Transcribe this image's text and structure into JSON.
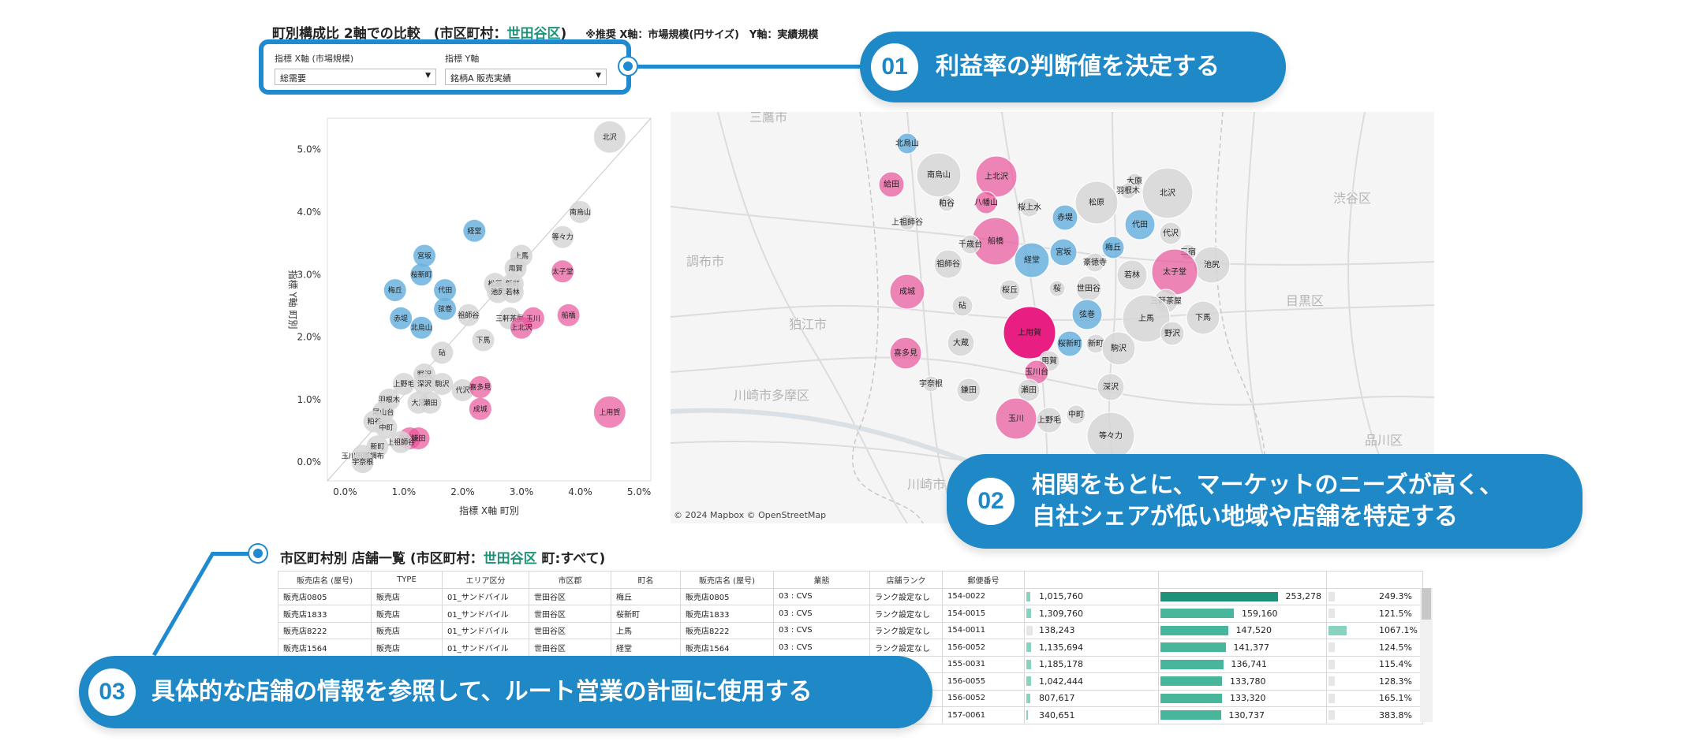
{
  "header": {
    "title_prefix": "町別構成比 2軸での比較　(市区町村：",
    "title_city": "世田谷区",
    "title_suffix": ")",
    "note": "※推奨 X軸：市場規模(円サイズ)　Y軸：実績規模"
  },
  "filters": {
    "x_label": "指標 X軸 (市場規模)",
    "x_value": "総需要",
    "y_label": "指標 Y軸",
    "y_value": "銘柄A 販売実績"
  },
  "callouts": [
    {
      "num": "01",
      "text": "利益率の判断値を決定する"
    },
    {
      "num": "02",
      "text": "相関をもとに、マーケットのニーズが高く、",
      "text2": "自社シェアが低い地域や店舗を特定する"
    },
    {
      "num": "03",
      "text": "具体的な店舗の情報を参照して、ルート営業の計画に使用する"
    }
  ],
  "colors": {
    "accent_blue": "#1f88c6",
    "green": "#1e9278",
    "pink": "#e8559a",
    "blue_dot": "#5aa9d6",
    "gray_dot": "#d4d4d4"
  },
  "chart_data": {
    "type": "scatter",
    "title": "",
    "xlabel": "指標 X軸 町別",
    "ylabel": "指標 Y軸 町別",
    "xlim": [
      -0.3,
      5.2
    ],
    "ylim": [
      -0.3,
      5.5
    ],
    "x_ticks": [
      "0.0%",
      "1.0%",
      "2.0%",
      "3.0%",
      "4.0%",
      "5.0%"
    ],
    "y_ticks": [
      "0.0%",
      "1.0%",
      "2.0%",
      "3.0%",
      "4.0%",
      "5.0%"
    ],
    "grid": false,
    "diagonal_reference_line": true,
    "points": [
      {
        "name": "北沢",
        "x": 4.5,
        "y": 5.2,
        "group": "gray"
      },
      {
        "name": "南烏山",
        "x": 4.0,
        "y": 4.0,
        "group": "gray"
      },
      {
        "name": "等々力",
        "x": 3.7,
        "y": 3.6,
        "group": "gray"
      },
      {
        "name": "経堂",
        "x": 2.2,
        "y": 3.7,
        "group": "blue"
      },
      {
        "name": "太子堂",
        "x": 3.7,
        "y": 3.05,
        "group": "pink"
      },
      {
        "name": "上馬",
        "x": 3.0,
        "y": 3.3,
        "group": "gray"
      },
      {
        "name": "用賀",
        "x": 2.9,
        "y": 3.1,
        "group": "gray"
      },
      {
        "name": "宮坂",
        "x": 1.35,
        "y": 3.3,
        "group": "blue"
      },
      {
        "name": "桜新町",
        "x": 1.3,
        "y": 3.0,
        "group": "blue"
      },
      {
        "name": "梅丘",
        "x": 0.85,
        "y": 2.75,
        "group": "blue"
      },
      {
        "name": "代田",
        "x": 1.7,
        "y": 2.75,
        "group": "blue"
      },
      {
        "name": "松原",
        "x": 2.55,
        "y": 2.85,
        "group": "gray"
      },
      {
        "name": "新町",
        "x": 2.85,
        "y": 2.85,
        "group": "gray"
      },
      {
        "name": "池尻",
        "x": 2.6,
        "y": 2.72,
        "group": "gray"
      },
      {
        "name": "若林",
        "x": 2.85,
        "y": 2.72,
        "group": "gray"
      },
      {
        "name": "弦巻",
        "x": 1.7,
        "y": 2.45,
        "group": "blue"
      },
      {
        "name": "赤堤",
        "x": 0.95,
        "y": 2.3,
        "group": "blue"
      },
      {
        "name": "祖師谷",
        "x": 2.1,
        "y": 2.35,
        "group": "gray"
      },
      {
        "name": "北烏山",
        "x": 1.3,
        "y": 2.15,
        "group": "blue"
      },
      {
        "name": "三軒茶屋",
        "x": 2.8,
        "y": 2.3,
        "group": "gray"
      },
      {
        "name": "玉川",
        "x": 3.2,
        "y": 2.3,
        "group": "pink"
      },
      {
        "name": "上北沢",
        "x": 3.0,
        "y": 2.15,
        "group": "pink"
      },
      {
        "name": "船橋",
        "x": 3.8,
        "y": 2.35,
        "group": "pink"
      },
      {
        "name": "下馬",
        "x": 2.35,
        "y": 1.95,
        "group": "gray"
      },
      {
        "name": "砧",
        "x": 1.65,
        "y": 1.75,
        "group": "gray"
      },
      {
        "name": "野沢",
        "x": 1.35,
        "y": 1.4,
        "group": "gray"
      },
      {
        "name": "上野毛",
        "x": 1.0,
        "y": 1.25,
        "group": "gray"
      },
      {
        "name": "深沢",
        "x": 1.35,
        "y": 1.25,
        "group": "gray"
      },
      {
        "name": "駒沢",
        "x": 1.65,
        "y": 1.25,
        "group": "gray"
      },
      {
        "name": "代沢",
        "x": 2.0,
        "y": 1.15,
        "group": "gray"
      },
      {
        "name": "喜多見",
        "x": 2.3,
        "y": 1.2,
        "group": "pink"
      },
      {
        "name": "羽根木",
        "x": 0.75,
        "y": 1.0,
        "group": "gray"
      },
      {
        "name": "大原",
        "x": 1.25,
        "y": 0.95,
        "group": "gray"
      },
      {
        "name": "瀬田",
        "x": 1.45,
        "y": 0.95,
        "group": "gray"
      },
      {
        "name": "成城",
        "x": 2.3,
        "y": 0.85,
        "group": "pink"
      },
      {
        "name": "上用賀",
        "x": 4.5,
        "y": 0.8,
        "group": "pink"
      },
      {
        "name": "尾山台",
        "x": 0.65,
        "y": 0.8,
        "group": "gray"
      },
      {
        "name": "粕谷",
        "x": 0.5,
        "y": 0.65,
        "group": "gray"
      },
      {
        "name": "中町",
        "x": 0.7,
        "y": 0.55,
        "group": "gray"
      },
      {
        "name": "八幡山",
        "x": 1.1,
        "y": 0.38,
        "group": "pink"
      },
      {
        "name": "鎌田",
        "x": 1.25,
        "y": 0.38,
        "group": "pink"
      },
      {
        "name": "上祖師谷",
        "x": 0.95,
        "y": 0.32,
        "group": "gray"
      },
      {
        "name": "新町",
        "x": 0.55,
        "y": 0.25,
        "group": "gray"
      },
      {
        "name": "玉川田園調布",
        "x": 0.3,
        "y": 0.1,
        "group": "gray"
      },
      {
        "name": "宇奈根",
        "x": 0.3,
        "y": 0.0,
        "group": "gray"
      }
    ]
  },
  "map": {
    "attribution": "© 2024 Mapbox © OpenStreetMap",
    "places": [
      "調布市",
      "狛江市",
      "川崎市多摩区",
      "目黒区",
      "渋谷区",
      "品川区",
      "三鷹市",
      "川崎市"
    ],
    "bubbles": [
      {
        "name": "北烏山",
        "color": "blue"
      },
      {
        "name": "南烏山",
        "color": "gray"
      },
      {
        "name": "上北沢",
        "color": "pink"
      },
      {
        "name": "八幡山",
        "color": "pink"
      },
      {
        "name": "給田",
        "color": "pink"
      },
      {
        "name": "粕谷",
        "color": "gray"
      },
      {
        "name": "桜上水",
        "color": "gray"
      },
      {
        "name": "松原",
        "color": "gray"
      },
      {
        "name": "大原",
        "color": "gray"
      },
      {
        "name": "羽根木",
        "color": "gray"
      },
      {
        "name": "北沢",
        "color": "gray"
      },
      {
        "name": "上祖師谷",
        "color": "gray"
      },
      {
        "name": "船橋",
        "color": "pink"
      },
      {
        "name": "赤堤",
        "color": "blue"
      },
      {
        "name": "代田",
        "color": "blue"
      },
      {
        "name": "代沢",
        "color": "gray"
      },
      {
        "name": "千歳台",
        "color": "gray"
      },
      {
        "name": "経堂",
        "color": "blue"
      },
      {
        "name": "宮坂",
        "color": "blue"
      },
      {
        "name": "梅丘",
        "color": "blue"
      },
      {
        "name": "豪徳寺",
        "color": "gray"
      },
      {
        "name": "三宿",
        "color": "gray"
      },
      {
        "name": "池尻",
        "color": "gray"
      },
      {
        "name": "祖師谷",
        "color": "gray"
      },
      {
        "name": "若林",
        "color": "gray"
      },
      {
        "name": "太子堂",
        "color": "pink"
      },
      {
        "name": "成城",
        "color": "pink"
      },
      {
        "name": "桜丘",
        "color": "gray"
      },
      {
        "name": "桜",
        "color": "gray"
      },
      {
        "name": "世田谷",
        "color": "gray"
      },
      {
        "name": "三軒茶屋",
        "color": "gray"
      },
      {
        "name": "砧",
        "color": "gray"
      },
      {
        "name": "弦巻",
        "color": "blue"
      },
      {
        "name": "上馬",
        "color": "gray"
      },
      {
        "name": "下馬",
        "color": "gray"
      },
      {
        "name": "野沢",
        "color": "gray"
      },
      {
        "name": "上用賀",
        "color": "pink-strong"
      },
      {
        "name": "大蔵",
        "color": "gray"
      },
      {
        "name": "喜多見",
        "color": "pink"
      },
      {
        "name": "桜新町",
        "color": "blue"
      },
      {
        "name": "新町",
        "color": "gray"
      },
      {
        "name": "駒沢",
        "color": "gray"
      },
      {
        "name": "用賀",
        "color": "gray"
      },
      {
        "name": "玉川台",
        "color": "pink"
      },
      {
        "name": "宇奈根",
        "color": "gray"
      },
      {
        "name": "鎌田",
        "color": "gray"
      },
      {
        "name": "瀬田",
        "color": "gray"
      },
      {
        "name": "深沢",
        "color": "gray"
      },
      {
        "name": "玉川",
        "color": "pink"
      },
      {
        "name": "上野毛",
        "color": "gray"
      },
      {
        "name": "中町",
        "color": "gray"
      },
      {
        "name": "等々力",
        "color": "gray"
      }
    ]
  },
  "table": {
    "title_prefix": "市区町村別 店舗一覧 (市区町村：",
    "title_city": "世田谷区",
    "title_suffix": " 町:すべて)",
    "headers": [
      "販売店名 (屋号)",
      "TYPE",
      "エリア区分",
      "市区郡",
      "町名",
      "販売店名 (屋号)",
      "業態",
      "店舗ランク",
      "郵便番号",
      "",
      "",
      ""
    ],
    "rows": [
      {
        "store": "販売店0805",
        "type": "販売店",
        "area": "01_サンドバイル",
        "city": "世田谷区",
        "town": "梅丘",
        "store2": "販売店0805",
        "biz": "03 : CVS",
        "rank": "ランク設定なし",
        "zip": "154-0022",
        "v1": "1,015,760",
        "v1f": 0.03,
        "v2": "253,278",
        "v2f": 0.99,
        "v2top": true,
        "pct": "249.3%",
        "pctf": 0.0
      },
      {
        "store": "販売店1833",
        "type": "販売店",
        "area": "01_サンドバイル",
        "city": "世田谷区",
        "town": "桜新町",
        "store2": "販売店1833",
        "biz": "03 : CVS",
        "rank": "ランク設定なし",
        "zip": "154-0015",
        "v1": "1,309,760",
        "v1f": 0.04,
        "v2": "159,160",
        "v2f": 0.62,
        "v2top": false,
        "pct": "121.5%",
        "pctf": 0.0
      },
      {
        "store": "販売店8222",
        "type": "販売店",
        "area": "01_サンドバイル",
        "city": "世田谷区",
        "town": "上馬",
        "store2": "販売店8222",
        "biz": "03 : CVS",
        "rank": "ランク設定なし",
        "zip": "154-0011",
        "v1": "138,243",
        "v1f": 0.0,
        "v2": "147,520",
        "v2f": 0.57,
        "v2top": false,
        "pct": "1067.1%",
        "pctf": 0.15
      },
      {
        "store": "販売店1564",
        "type": "販売店",
        "area": "01_サンドバイル",
        "city": "世田谷区",
        "town": "経堂",
        "store2": "販売店1564",
        "biz": "03 : CVS",
        "rank": "ランク設定なし",
        "zip": "156-0052",
        "v1": "1,135,694",
        "v1f": 0.04,
        "v2": "141,377",
        "v2f": 0.55,
        "v2top": false,
        "pct": "124.5%",
        "pctf": 0.0
      },
      {
        "store": "",
        "type": "",
        "area": "",
        "city": "",
        "town": "",
        "store2": "",
        "biz": "",
        "rank": "",
        "zip": "155-0031",
        "v1": "1,185,178",
        "v1f": 0.04,
        "v2": "136,741",
        "v2f": 0.53,
        "v2top": false,
        "pct": "115.4%",
        "pctf": 0.0
      },
      {
        "store": "",
        "type": "",
        "area": "",
        "city": "",
        "town": "",
        "store2": "",
        "biz": "",
        "rank": "",
        "zip": "156-0055",
        "v1": "1,042,444",
        "v1f": 0.04,
        "v2": "133,780",
        "v2f": 0.52,
        "v2top": false,
        "pct": "128.3%",
        "pctf": 0.0
      },
      {
        "store": "",
        "type": "",
        "area": "",
        "city": "",
        "town": "",
        "store2": "",
        "biz": "",
        "rank": "",
        "zip": "156-0052",
        "v1": "807,617",
        "v1f": 0.03,
        "v2": "133,320",
        "v2f": 0.52,
        "v2top": false,
        "pct": "165.1%",
        "pctf": 0.0
      },
      {
        "store": "",
        "type": "",
        "area": "",
        "city": "",
        "town": "",
        "store2": "",
        "biz": "",
        "rank": "",
        "zip": "157-0061",
        "v1": "340,651",
        "v1f": 0.01,
        "v2": "130,737",
        "v2f": 0.51,
        "v2top": false,
        "pct": "383.8%",
        "pctf": 0.0
      }
    ]
  }
}
